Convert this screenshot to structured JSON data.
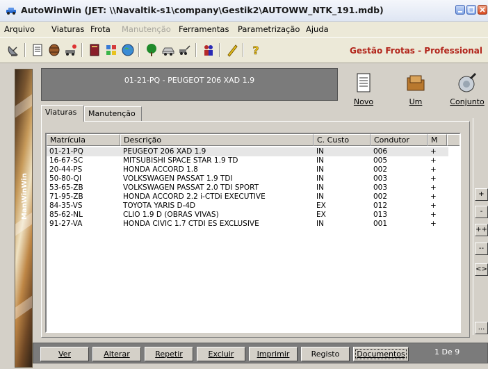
{
  "window": {
    "title": "AutoWinWin (JET: \\\\Navaltik-s1\\company\\Gestik2\\AUTOWW_NTK_191.mdb)"
  },
  "menu": {
    "items": [
      {
        "label": "Arquivo",
        "enabled": true
      },
      {
        "label": "Viaturas",
        "enabled": true
      },
      {
        "label": "Frota",
        "enabled": true
      },
      {
        "label": "Manutenção",
        "enabled": false
      },
      {
        "label": "Ferramentas",
        "enabled": true
      },
      {
        "label": "Parametrização",
        "enabled": true
      },
      {
        "label": "Ajuda",
        "enabled": true
      }
    ]
  },
  "toolbar": {
    "brand": "Gestão Frotas - Professional",
    "icons": [
      "satellite-dish-icon",
      "document-list-icon",
      "barrel-icon",
      "car-wash-icon",
      "book-icon",
      "tools-icon",
      "globe-icon",
      "tree-icon",
      "car-icon",
      "tow-truck-icon",
      "people-icon",
      "pencil-icon",
      "help-icon"
    ]
  },
  "sidebar": {
    "vertical_label": "ManWinWin"
  },
  "record": {
    "banner": "01-21-PQ - PEUGEOT 206 XAD 1.9"
  },
  "actions": {
    "novo": "Novo",
    "um": "Um",
    "conjunto": "Conjunto"
  },
  "tabs": [
    {
      "label": "Viaturas",
      "active": true
    },
    {
      "label": "Manutenção",
      "active": false
    }
  ],
  "table": {
    "columns": [
      "Matrícula",
      "Descrição",
      "C. Custo",
      "Condutor",
      "M"
    ],
    "rows": [
      [
        "01-21-PQ",
        "PEUGEOT 206 XAD 1.9",
        "IN",
        "006",
        "+"
      ],
      [
        "16-67-SC",
        "MITSUBISHI SPACE STAR 1.9 TD",
        "IN",
        "005",
        "+"
      ],
      [
        "20-44-PS",
        "HONDA ACCORD 1.8",
        "IN",
        "002",
        "+"
      ],
      [
        "50-80-QI",
        "VOLKSWAGEN PASSAT 1.9 TDI",
        "IN",
        "003",
        "+"
      ],
      [
        "53-65-ZB",
        "VOLKSWAGEN PASSAT 2.0 TDI SPORT",
        "IN",
        "003",
        "+"
      ],
      [
        "71-95-ZB",
        "HONDA ACCORD 2.2 i-CTDi EXECUTIVE",
        "IN",
        "002",
        "+"
      ],
      [
        "84-35-VS",
        "TOYOTA YARIS D-4D",
        "EX",
        "012",
        "+"
      ],
      [
        "85-62-NL",
        "CLIO 1.9 D (OBRAS VIVAS)",
        "EX",
        "013",
        "+"
      ],
      [
        "91-27-VA",
        "HONDA CIVIC 1.7 CTDI ES EXCLUSIVE",
        "IN",
        "001",
        "+"
      ]
    ]
  },
  "side_buttons": [
    "+",
    "-",
    "++",
    "--",
    "<>",
    "..."
  ],
  "bottom": {
    "ver": "Ver",
    "alterar": "Alterar",
    "repetir": "Repetir",
    "excluir": "Excluir",
    "imprimir": "Imprimir",
    "registo": "Registo",
    "documentos": "Documentos",
    "pager": "1 De 9"
  },
  "colors": {
    "brand": "#b2251b",
    "banner": "#7b7b7b",
    "face": "#d4d0c8"
  }
}
